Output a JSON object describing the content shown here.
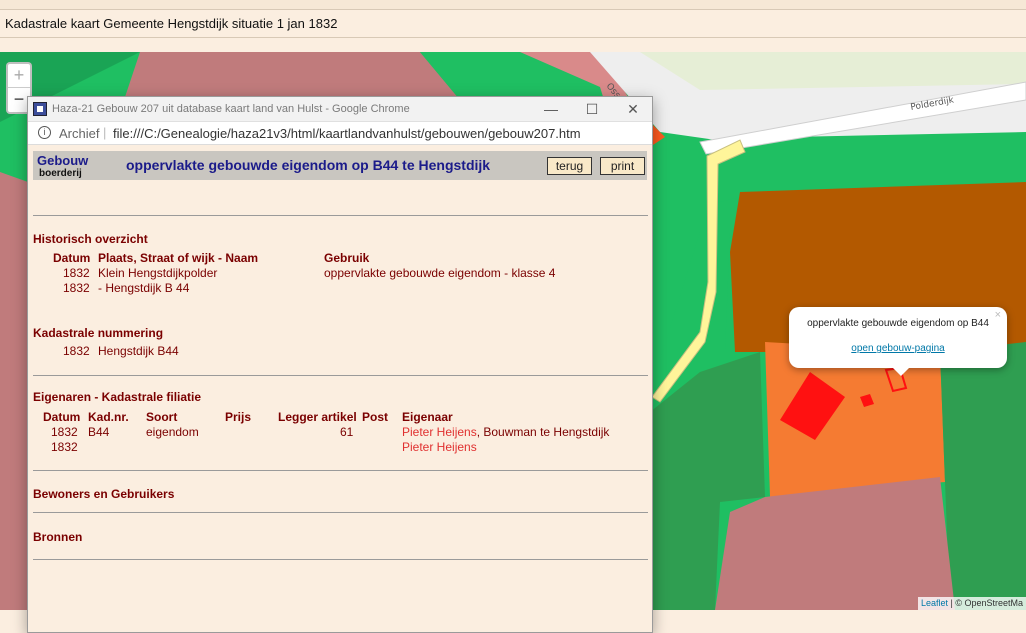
{
  "page_title": "Kadastrale kaart Gemeente Hengstdijk situatie 1 jan 1832",
  "map": {
    "zoom_in": "+",
    "zoom_out": "−",
    "street_ossense": "Ossense",
    "street_polderdijk": "Polderdijk",
    "attribution_link": "Leaflet",
    "attribution_rest": " | © OpenStreetMa",
    "popup": {
      "title": "oppervlakte gebouwde eigendom op B44",
      "link": "open gebouw-pagina",
      "close": "×"
    }
  },
  "window": {
    "title": "Haza-21 Gebouw 207 uit database kaart land van Hulst - Google Chrome",
    "minimize": "—",
    "maximize": "☐",
    "close": "✕",
    "address": {
      "info": "i",
      "label": "Archief",
      "separator": "|",
      "url": "file:///C:/Genealogie/haza21v3/html/kaartlandvanhulst/gebouwen/gebouw207.htm"
    }
  },
  "doc": {
    "header": {
      "type": "Gebouw",
      "subtype": "boerderij",
      "title": "oppervlakte gebouwde eigendom op B44 te Hengstdijk",
      "back_button": "terug",
      "print_button": "print"
    },
    "historisch": {
      "heading": "Historisch overzicht",
      "col_datum": "Datum",
      "col_plaats": "Plaats, Straat of wijk - Naam",
      "col_gebruik": "Gebruik",
      "rows": [
        {
          "datum": "1832",
          "plaats": "Klein Hengstdijkpolder",
          "gebruik": "oppervlakte gebouwde eigendom - klasse 4"
        },
        {
          "datum": "1832",
          "plaats": "- Hengstdijk B 44",
          "gebruik": ""
        }
      ]
    },
    "kadastraal": {
      "heading": "Kadastrale nummering",
      "rows": [
        {
          "datum": "1832",
          "naam": "Hengstdijk B44"
        }
      ]
    },
    "eigenaren": {
      "heading": "Eigenaren - Kadastrale filiatie",
      "col_datum": "Datum",
      "col_kad": "Kad.nr.",
      "col_soort": "Soort",
      "col_prijs": "Prijs",
      "col_legger": "Legger artikel",
      "col_post": "Post",
      "col_eigenaar": "Eigenaar",
      "rows": [
        {
          "datum": "1832",
          "kad": "B44",
          "soort": "eigendom",
          "legger": "61",
          "eigenaar_link": "Pieter Heijens",
          "eigenaar_rest": ", Bouwman te Hengstdijk"
        },
        {
          "datum": "1832",
          "kad": "",
          "soort": "",
          "legger": "",
          "eigenaar_link": "Pieter Heijens",
          "eigenaar_rest": ""
        }
      ]
    },
    "bewoners": {
      "heading": "Bewoners en Gebruikers"
    },
    "bronnen": {
      "heading": "Bronnen"
    }
  }
}
